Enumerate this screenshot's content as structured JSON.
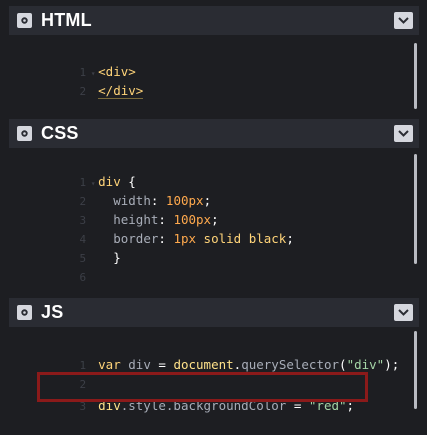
{
  "html_panel": {
    "title": "HTML",
    "lines": [
      {
        "num": "1",
        "text": "<div>"
      },
      {
        "num": "2",
        "text": "</div>"
      }
    ]
  },
  "css_panel": {
    "title": "CSS",
    "lines": [
      {
        "num": "1",
        "selector": "div",
        "brace": " {"
      },
      {
        "num": "2",
        "prop": "width",
        "value": "100px"
      },
      {
        "num": "3",
        "prop": "height",
        "value": "100px"
      },
      {
        "num": "4",
        "prop": "border",
        "value_num": "1px",
        "value_rest": " solid black"
      },
      {
        "num": "5",
        "brace": "}"
      },
      {
        "num": "6"
      }
    ]
  },
  "js_panel": {
    "title": "JS",
    "lines": [
      {
        "num": "1",
        "kw": "var",
        "var": "div",
        "eq": "=",
        "obj": "document",
        "dot": ".",
        "method": "querySelector",
        "str": "\"div\"",
        "end": ";"
      },
      {
        "num": "2"
      },
      {
        "num": "3",
        "obj": "div",
        "prop_chain": ".style.backgroundColor",
        "eq": "=",
        "str": "\"red\"",
        "end": ";"
      }
    ]
  },
  "icons": {
    "settings": "gear-icon",
    "collapse": "chevron-down-icon"
  },
  "colors": {
    "highlight_border": "#8b1a1a"
  }
}
